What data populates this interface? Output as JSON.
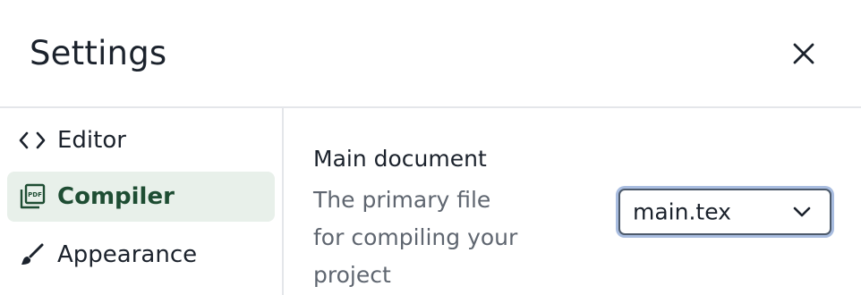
{
  "dialog": {
    "title": "Settings"
  },
  "sidebar": {
    "items": [
      {
        "label": "Editor",
        "icon": "code-icon",
        "active": false
      },
      {
        "label": "Compiler",
        "icon": "pdf-file-icon",
        "active": true
      },
      {
        "label": "Appearance",
        "icon": "brush-icon",
        "active": false
      }
    ]
  },
  "main": {
    "setting": {
      "title": "Main document",
      "description": "The primary file for compiling your project",
      "selected_value": "main.tex"
    }
  },
  "colors": {
    "active_bg": "#e8f0ea",
    "active_text": "#1e4d33",
    "focus_ring": "#a9bde0"
  }
}
